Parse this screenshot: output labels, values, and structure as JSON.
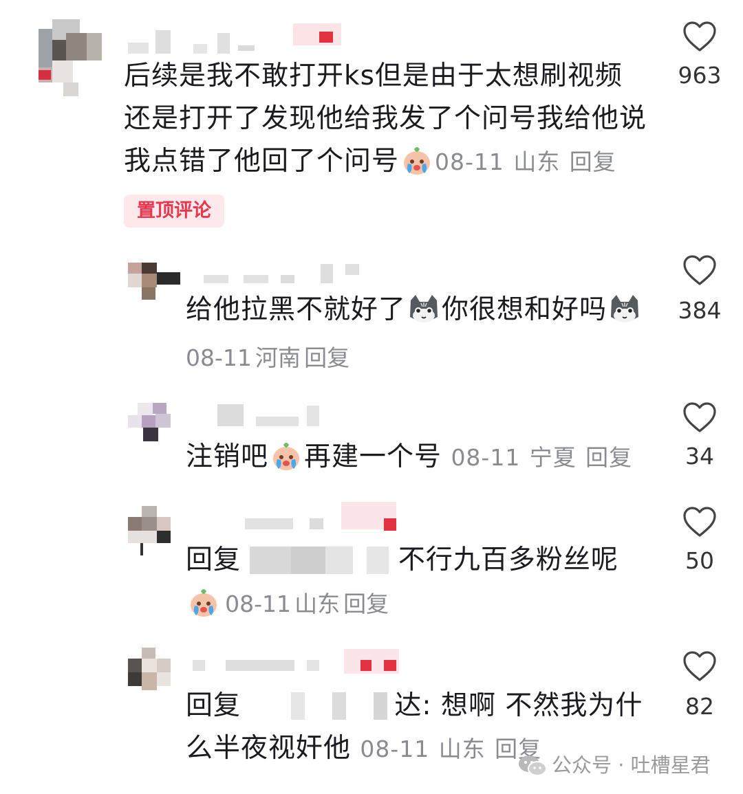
{
  "comments": [
    {
      "text_lines": [
        "后续是我不敢打开ks但是由于太想刷视频",
        "还是打开了发现他给我发了个问号我给他说",
        "我点错了他回了个问号"
      ],
      "emoji": "crying-face",
      "date": "08-11",
      "location": "山东",
      "reply_label": "回复",
      "likes": "963",
      "pin_label": "置顶评论"
    },
    {
      "text_part1": "给他拉黑不就好了",
      "emoji1": "cat-face",
      "text_part2": "你很想和好吗",
      "emoji2": "cat-face",
      "date": "08-11",
      "location": "河南",
      "reply_label": "回复",
      "likes": "384"
    },
    {
      "text_part1": "注销吧",
      "emoji": "crying-face",
      "text_part2": "再建一个号",
      "date": "08-11",
      "location": "宁夏",
      "reply_label": "回复",
      "likes": "34"
    },
    {
      "prefix": "回复",
      "text": "不行九百多粉丝呢",
      "emoji": "crying-face",
      "date": "08-11",
      "location": "山东",
      "reply_label": "回复",
      "likes": "50"
    },
    {
      "prefix": "回复",
      "name_tail": "达:",
      "text_line1": "想啊 不然我为什",
      "text_line2": "么半夜视奸他",
      "date": "08-11",
      "location": "山东",
      "reply_label": "回复",
      "likes": "82"
    }
  ],
  "watermark": {
    "icon": "wechat-icon",
    "text": "公众号 · 吐槽星君"
  },
  "colors": {
    "text": "#1b1b1f",
    "meta": "#8a8b91",
    "pin_bg": "#fde8ec",
    "pin_text": "#e8374f"
  }
}
